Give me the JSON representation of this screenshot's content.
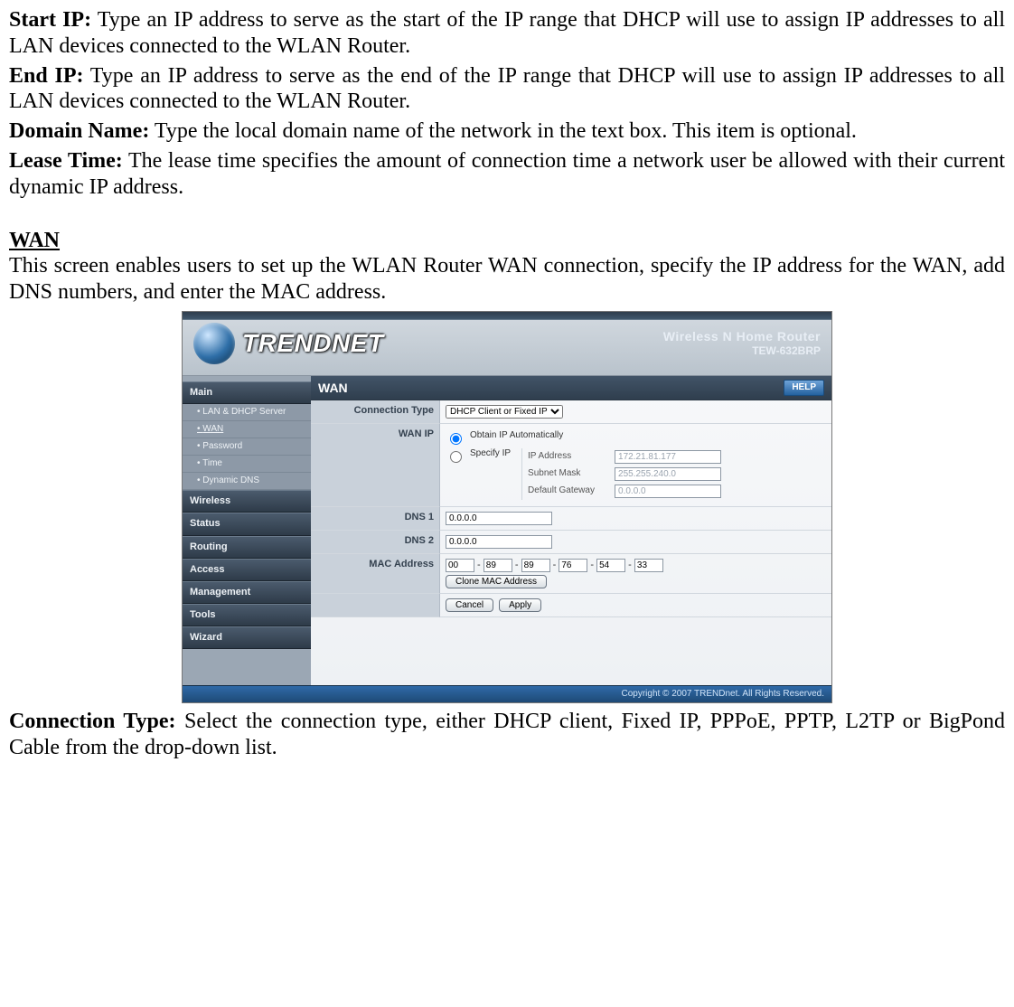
{
  "doc": {
    "start_ip_label": "Start IP:",
    "start_ip_text": " Type an IP address to serve as the start of the IP range that DHCP will use to assign IP addresses to all LAN devices connected to the WLAN Router.",
    "end_ip_label": "End IP:",
    "end_ip_text": " Type an IP address to serve as the end of the IP range that DHCP will use to assign IP addresses to all LAN devices connected to the WLAN Router.",
    "domain_label": "Domain Name:",
    "domain_text": " Type the local domain name of the network in the text box. This item is optional.",
    "lease_label": "Lease Time:",
    "lease_text": "  The lease time specifies the amount of connection time a network user be allowed with their current dynamic IP address.",
    "wan_heading": "WAN",
    "wan_intro": "This screen enables users to set up the WLAN Router WAN connection, specify the IP address for the WAN, add DNS numbers, and enter the MAC address.",
    "conn_type_label": "Connection Type:",
    "conn_type_text": " Select the connection type, either DHCP client, Fixed IP, PPPoE, PPTP, L2TP or BigPond Cable from the drop-down list."
  },
  "router": {
    "brand": "TRENDNET",
    "product_line1": "Wireless N Home Router",
    "product_line2": "TEW-632BRP",
    "footer": "Copyright © 2007 TRENDnet. All Rights Reserved.",
    "nav": {
      "main": "Main",
      "subs": [
        "LAN & DHCP Server",
        "WAN",
        "Password",
        "Time",
        "Dynamic DNS"
      ],
      "cats": [
        "Wireless",
        "Status",
        "Routing",
        "Access",
        "Management",
        "Tools",
        "Wizard"
      ]
    },
    "panel": {
      "title": "WAN",
      "help": "HELP",
      "rows": {
        "conn_type": "Connection Type",
        "conn_type_value": "DHCP Client or Fixed IP",
        "wan_ip": "WAN IP",
        "obtain": "Obtain IP Automatically",
        "specify": "Specify IP",
        "ip_address_lbl": "IP Address",
        "ip_address_val": "172.21.81.177",
        "subnet_lbl": "Subnet Mask",
        "subnet_val": "255.255.240.0",
        "gw_lbl": "Default Gateway",
        "gw_val": "0.0.0.0",
        "dns1": "DNS 1",
        "dns1_val": "0.0.0.0",
        "dns2": "DNS 2",
        "dns2_val": "0.0.0.0",
        "mac": "MAC Address",
        "mac_vals": [
          "00",
          "89",
          "89",
          "76",
          "54",
          "33"
        ],
        "clone": "Clone MAC Address",
        "cancel": "Cancel",
        "apply": "Apply"
      }
    }
  }
}
